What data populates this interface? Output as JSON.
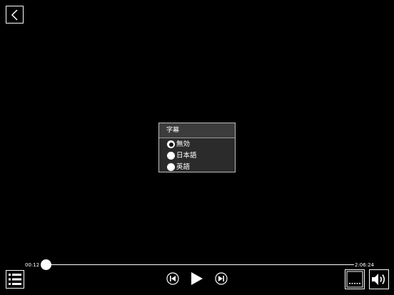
{
  "player": {
    "position_fraction": 0.0,
    "time_elapsed": "00:12",
    "time_total": "2:06:24"
  },
  "subtitle_dialog": {
    "title": "字幕",
    "options": [
      {
        "label": "無効",
        "selected": true
      },
      {
        "label": "日本語",
        "selected": false
      },
      {
        "label": "英語",
        "selected": false
      }
    ]
  },
  "icons": {
    "back": "chevron-left-icon",
    "playlist": "list-icon",
    "previous": "skip-previous-icon",
    "play": "play-icon",
    "next": "skip-next-icon",
    "subtitles": "subtitles-icon",
    "volume": "volume-icon"
  },
  "colors": {
    "background": "#000000",
    "foreground": "#ffffff",
    "dialog_bg": "#2b2b2b"
  }
}
